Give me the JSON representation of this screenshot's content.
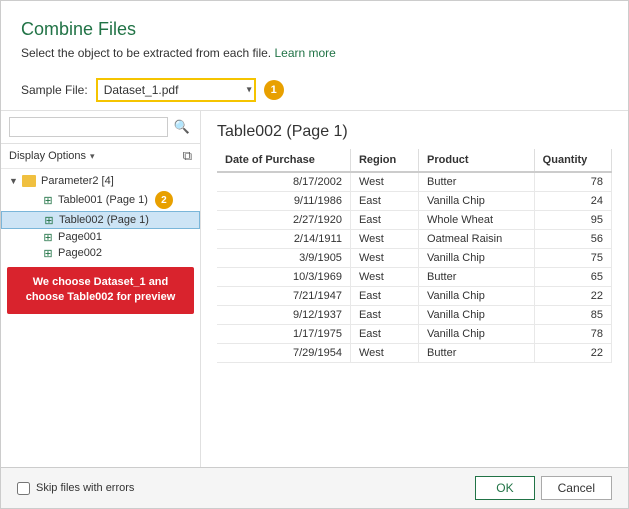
{
  "dialog": {
    "title": "Combine Files",
    "subtitle": "Select the object to be extracted from each file.",
    "learn_more": "Learn more",
    "sample_file_label": "Sample File:",
    "sample_file_value": "Dataset_1.pdf",
    "badge1": "1",
    "badge2": "2"
  },
  "left_panel": {
    "search_placeholder": "",
    "display_options": "Display Options",
    "tree": {
      "root": "Parameter2 [4]",
      "items": [
        {
          "label": "Table001 (Page 1)",
          "indent": 2,
          "type": "table",
          "selected": false
        },
        {
          "label": "Table002 (Page 1)",
          "indent": 2,
          "type": "table",
          "selected": true
        },
        {
          "label": "Page001",
          "indent": 2,
          "type": "table",
          "selected": false
        },
        {
          "label": "Page002",
          "indent": 2,
          "type": "table",
          "selected": false
        }
      ]
    },
    "red_box": "We choose Dataset_1 and choose Table002 for preview"
  },
  "right_panel": {
    "table_title": "Table002 (Page 1)",
    "columns": [
      "Date of Purchase",
      "Region",
      "Product",
      "Quantity"
    ],
    "rows": [
      [
        "8/17/2002",
        "West",
        "Butter",
        "78"
      ],
      [
        "9/11/1986",
        "East",
        "Vanilla Chip",
        "24"
      ],
      [
        "2/27/1920",
        "East",
        "Whole Wheat",
        "95"
      ],
      [
        "2/14/1911",
        "West",
        "Oatmeal Raisin",
        "56"
      ],
      [
        "3/9/1905",
        "West",
        "Vanilla Chip",
        "75"
      ],
      [
        "10/3/1969",
        "West",
        "Butter",
        "65"
      ],
      [
        "7/21/1947",
        "East",
        "Vanilla Chip",
        "22"
      ],
      [
        "9/12/1937",
        "East",
        "Vanilla Chip",
        "85"
      ],
      [
        "1/17/1975",
        "East",
        "Vanilla Chip",
        "78"
      ],
      [
        "7/29/1954",
        "West",
        "Butter",
        "22"
      ]
    ]
  },
  "footer": {
    "skip_label": "Skip files with errors",
    "ok_label": "OK",
    "cancel_label": "Cancel"
  }
}
